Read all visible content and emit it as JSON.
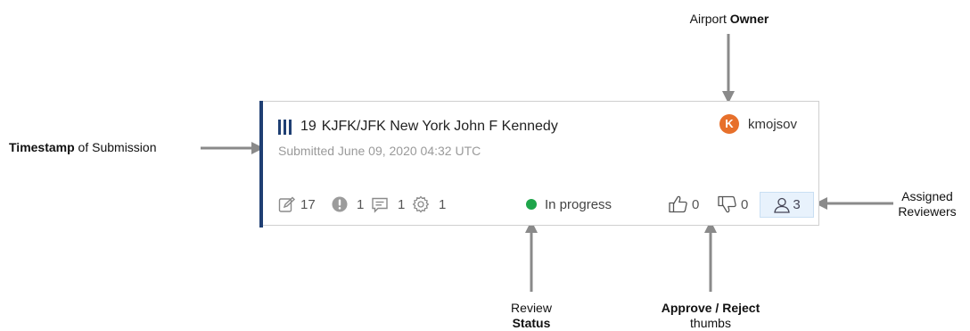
{
  "callouts": {
    "owner": {
      "pre": "Airport ",
      "bold": "Owner"
    },
    "timestamp": {
      "bold": "Timestamp",
      "post": " of Submission"
    },
    "reviewers": {
      "line1": "Assigned",
      "line2": "Reviewers"
    },
    "status": {
      "line1": "Review",
      "line2_bold": "Status"
    },
    "approve": {
      "line1_bold": "Approve / Reject",
      "line2": "thumbs"
    }
  },
  "card": {
    "id_number": "19",
    "title": "KJFK/JFK New York John F Kennedy",
    "submitted": "Submitted June 09, 2020 04:32 UTC",
    "owner": {
      "initial": "K",
      "username": "kmojsov",
      "avatar_color": "#e7702b"
    },
    "accent_color": "#1f3f73",
    "stats": {
      "edits": "17",
      "issues": "1",
      "comments": "1",
      "settings": "1"
    },
    "status": {
      "label": "In progress",
      "color": "#1ea54a"
    },
    "votes": {
      "approve": "0",
      "reject": "0"
    },
    "reviewers_count": "3",
    "icons": [
      "edit-icon",
      "alert-icon",
      "comment-icon",
      "gear-icon",
      "thumbs-up-icon",
      "thumbs-down-icon",
      "user-icon"
    ]
  }
}
